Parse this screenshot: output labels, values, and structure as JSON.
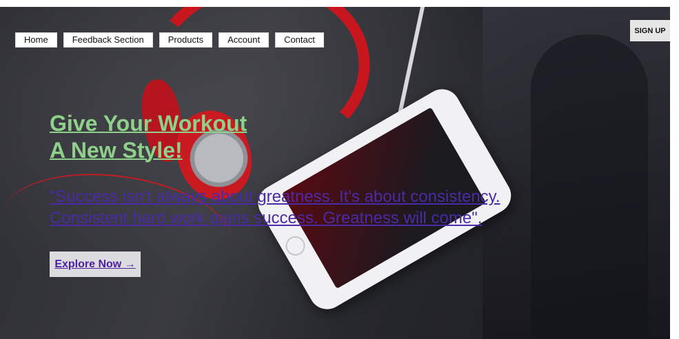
{
  "nav": {
    "items": [
      {
        "label": "Home"
      },
      {
        "label": "Feedback Section"
      },
      {
        "label": "Products"
      },
      {
        "label": "Account"
      },
      {
        "label": "Contact"
      }
    ],
    "signup_label": "SIGN UP"
  },
  "hero": {
    "headline_line1": "Give Your Workout",
    "headline_line2": "A New Style!",
    "quote_line1": "\"Success isn't always about greatness. It's about consistency.",
    "quote_line2": "Consistent hard work gains success. Greatness will come\".",
    "cta_label": "Explore Now →"
  },
  "colors": {
    "headline": "#8fd08a",
    "quote": "#4b2aa8",
    "cta_text": "#4b1fa0",
    "hero_bg": "#2b2c31",
    "headphone_red": "#c8161f"
  }
}
